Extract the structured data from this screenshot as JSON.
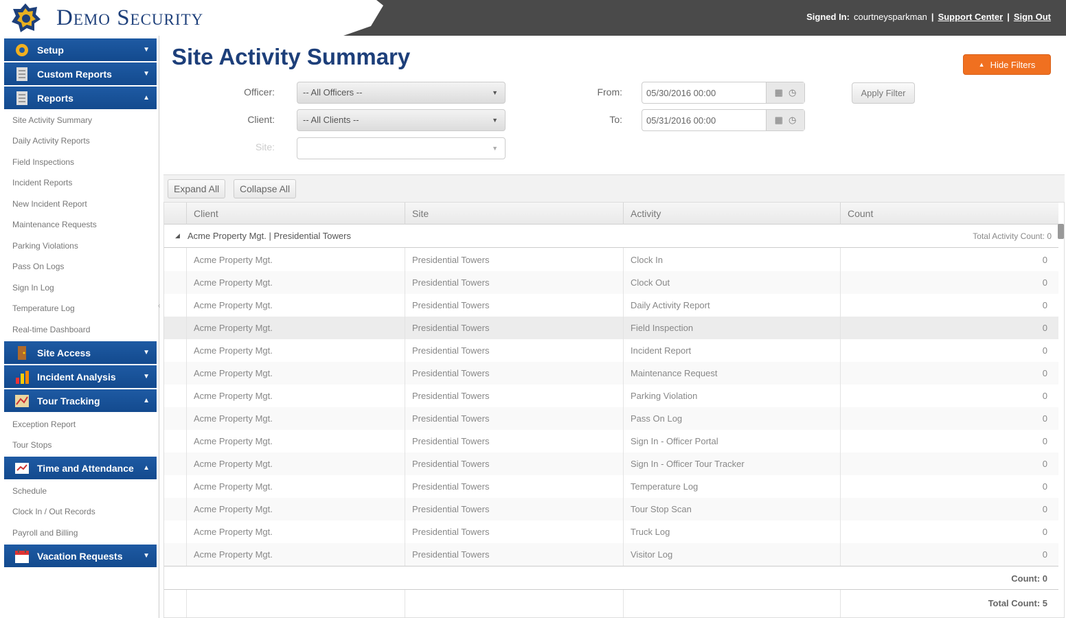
{
  "header": {
    "brand": "Demo Security",
    "signed_in_label": "Signed In:",
    "username": "courtneysparkman",
    "support_link": "Support Center",
    "signout_link": "Sign Out",
    "separator": "|"
  },
  "sidebar": {
    "sections": {
      "setup": "Setup",
      "custom_reports": "Custom Reports",
      "reports": "Reports",
      "site_access": "Site Access",
      "incident_analysis": "Incident Analysis",
      "tour_tracking": "Tour Tracking",
      "time_attendance": "Time and Attendance",
      "vacation": "Vacation Requests"
    },
    "reports_items": [
      "Site Activity Summary",
      "Daily Activity Reports",
      "Field Inspections",
      "Incident Reports",
      "New Incident Report",
      "Maintenance Requests",
      "Parking Violations",
      "Pass On Logs",
      "Sign In Log",
      "Temperature Log",
      "Real-time Dashboard"
    ],
    "tour_items": [
      "Exception Report",
      "Tour Stops"
    ],
    "time_items": [
      "Schedule",
      "Clock In / Out Records",
      "Payroll and Billing"
    ]
  },
  "page": {
    "title": "Site Activity Summary",
    "hide_filters": "Hide Filters"
  },
  "filters": {
    "officer_label": "Officer:",
    "officer_value": "-- All Officers --",
    "client_label": "Client:",
    "client_value": "-- All Clients --",
    "site_label": "Site:",
    "site_value": "",
    "from_label": "From:",
    "from_value": "05/30/2016 00:00",
    "to_label": "To:",
    "to_value": "05/31/2016 00:00",
    "apply": "Apply Filter"
  },
  "grid": {
    "expand_all": "Expand All",
    "collapse_all": "Collapse All",
    "columns": [
      "Client",
      "Site",
      "Activity",
      "Count"
    ],
    "group_title": "Acme Property Mgt. | Presidential Towers",
    "group_count": "Total Activity Count: 0",
    "rows": [
      {
        "client": "Acme Property Mgt.",
        "site": "Presidential Towers",
        "activity": "Clock In",
        "count": "0"
      },
      {
        "client": "Acme Property Mgt.",
        "site": "Presidential Towers",
        "activity": "Clock Out",
        "count": "0"
      },
      {
        "client": "Acme Property Mgt.",
        "site": "Presidential Towers",
        "activity": "Daily Activity Report",
        "count": "0"
      },
      {
        "client": "Acme Property Mgt.",
        "site": "Presidential Towers",
        "activity": "Field Inspection",
        "count": "0"
      },
      {
        "client": "Acme Property Mgt.",
        "site": "Presidential Towers",
        "activity": "Incident Report",
        "count": "0"
      },
      {
        "client": "Acme Property Mgt.",
        "site": "Presidential Towers",
        "activity": "Maintenance Request",
        "count": "0"
      },
      {
        "client": "Acme Property Mgt.",
        "site": "Presidential Towers",
        "activity": "Parking Violation",
        "count": "0"
      },
      {
        "client": "Acme Property Mgt.",
        "site": "Presidential Towers",
        "activity": "Pass On Log",
        "count": "0"
      },
      {
        "client": "Acme Property Mgt.",
        "site": "Presidential Towers",
        "activity": "Sign In - Officer Portal",
        "count": "0"
      },
      {
        "client": "Acme Property Mgt.",
        "site": "Presidential Towers",
        "activity": "Sign In - Officer Tour Tracker",
        "count": "0"
      },
      {
        "client": "Acme Property Mgt.",
        "site": "Presidential Towers",
        "activity": "Temperature Log",
        "count": "0"
      },
      {
        "client": "Acme Property Mgt.",
        "site": "Presidential Towers",
        "activity": "Tour Stop Scan",
        "count": "0"
      },
      {
        "client": "Acme Property Mgt.",
        "site": "Presidential Towers",
        "activity": "Truck Log",
        "count": "0"
      },
      {
        "client": "Acme Property Mgt.",
        "site": "Presidential Towers",
        "activity": "Visitor Log",
        "count": "0"
      }
    ],
    "group_footer": "Count: 0",
    "total_footer": "Total Count: 5"
  }
}
